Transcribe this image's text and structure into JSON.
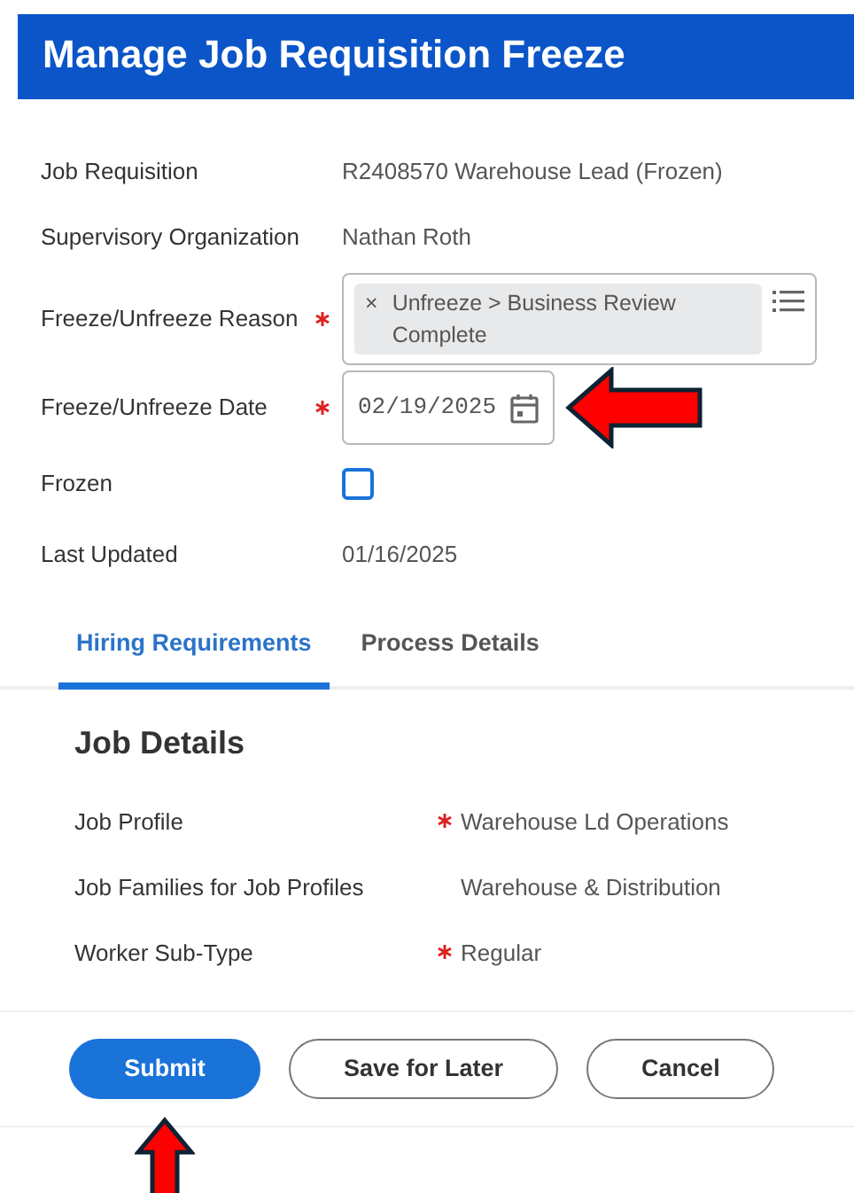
{
  "window": {
    "title": "Manage Job Requisition Freeze"
  },
  "fields": [
    {
      "label": "Job Requisition",
      "kind": "text",
      "required": false,
      "value": "R2408570 Warehouse Lead (Frozen)"
    },
    {
      "label": "Supervisory Organization",
      "kind": "text",
      "required": false,
      "value": "Nathan Roth"
    },
    {
      "label": "Freeze/Unfreeze Reason",
      "kind": "multiselect",
      "required": true,
      "chip": "×",
      "value": "Unfreeze > Business Review Complete"
    },
    {
      "label": "Freeze/Unfreeze Date",
      "kind": "date",
      "required": true,
      "value": "02/19/2025",
      "arrow": true
    },
    {
      "label": "Frozen",
      "kind": "checkbox",
      "required": false,
      "checked": false
    },
    {
      "label": "Last Updated",
      "kind": "text",
      "required": false,
      "value": "01/16/2025"
    }
  ],
  "tabs": [
    {
      "label": "Hiring Requirements",
      "selected": true
    },
    {
      "label": "Process Details",
      "selected": false
    }
  ],
  "section": {
    "title": "Job Details",
    "fields": [
      {
        "label": "Job Profile",
        "required": true,
        "value": "Warehouse Ld Operations"
      },
      {
        "label": "Job Families for Job Profiles",
        "required": false,
        "value": "Warehouse & Distribution"
      },
      {
        "label": "Worker Sub-Type",
        "required": true,
        "value": "Regular"
      }
    ]
  },
  "buttons": [
    {
      "label": "Submit",
      "kind": "primary",
      "arrow": true
    },
    {
      "label": "Save for Later",
      "kind": "secondary",
      "arrow": false
    },
    {
      "label": "Cancel",
      "kind": "secondary",
      "arrow": false
    }
  ]
}
